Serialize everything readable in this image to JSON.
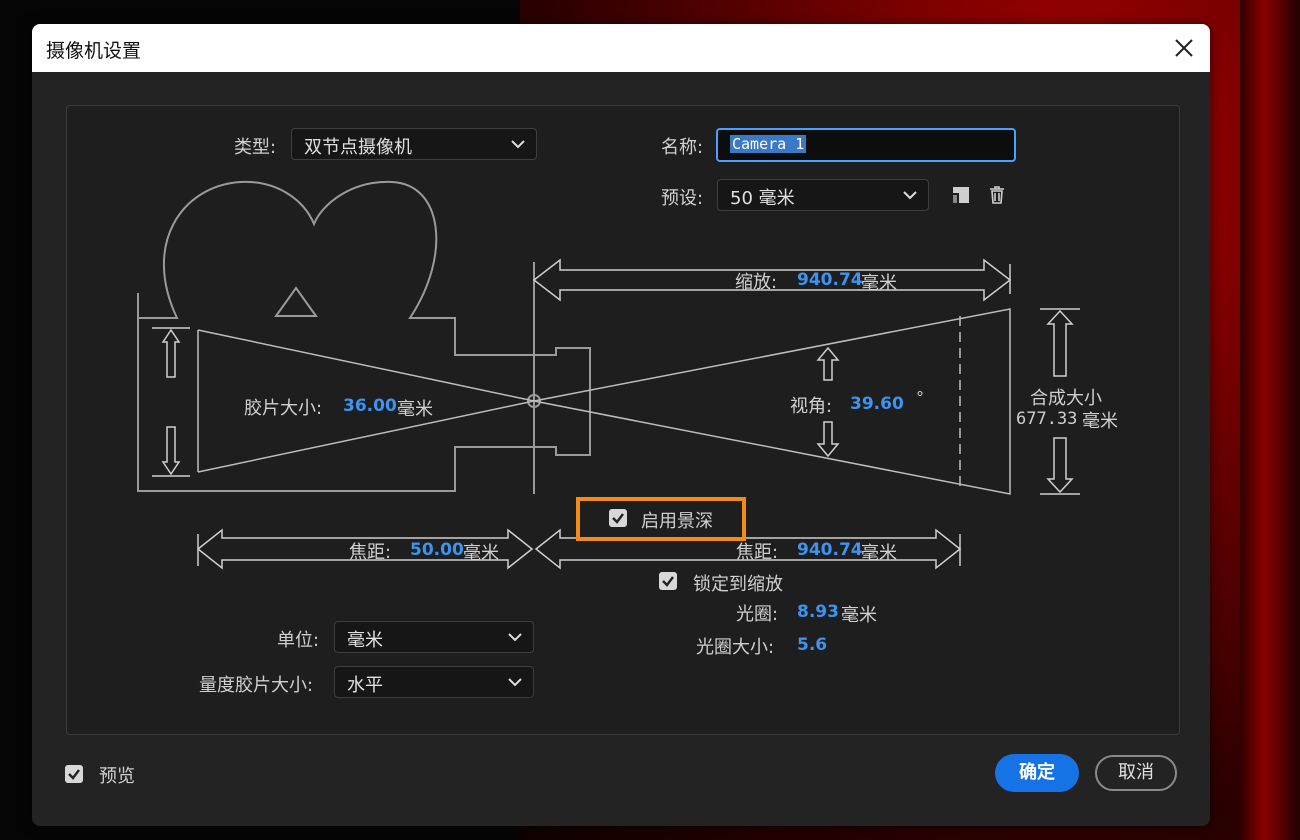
{
  "dialog": {
    "title": "摄像机设置"
  },
  "type": {
    "label": "类型:",
    "value": "双节点摄像机"
  },
  "name": {
    "label": "名称:",
    "value": "Camera 1"
  },
  "preset": {
    "label": "预设:",
    "value": "50 毫米"
  },
  "zoom": {
    "label": "缩放:",
    "value": "940.74",
    "unit": "毫米"
  },
  "film_size": {
    "label": "胶片大小:",
    "value": "36.00",
    "unit": "毫米"
  },
  "angle_of_view": {
    "label": "视角:",
    "value": "39.60",
    "unit": "°"
  },
  "comp_size": {
    "label": "合成大小",
    "value": "677.33",
    "unit": "毫米"
  },
  "enable_dof": {
    "label": "启用景深",
    "checked": true
  },
  "focal_length": {
    "label": "焦距:",
    "value": "50.00",
    "unit": "毫米"
  },
  "focus_distance": {
    "label": "焦距:",
    "value": "940.74",
    "unit": "毫米"
  },
  "lock_to_zoom": {
    "label": "锁定到缩放",
    "checked": true
  },
  "aperture": {
    "label": "光圈:",
    "value": "8.93",
    "unit": "毫米"
  },
  "f_stop": {
    "label": "光圈大小:",
    "value": "5.6"
  },
  "units": {
    "label": "单位:",
    "value": "毫米"
  },
  "measure_film_size": {
    "label": "量度胶片大小:",
    "value": "水平"
  },
  "preview": {
    "label": "预览",
    "checked": true
  },
  "buttons": {
    "ok": "确定",
    "cancel": "取消"
  },
  "icons": {
    "close": "close-icon",
    "save_preset": "save-preset-icon",
    "delete_preset": "trash-icon",
    "dropdown": "chevron-down-icon",
    "checkbox": "checkmark-icon"
  },
  "colors": {
    "accent": "#1673e6",
    "value_text": "#3c93f0",
    "highlight": "#f28c18",
    "dialog_bg": "#232323"
  }
}
